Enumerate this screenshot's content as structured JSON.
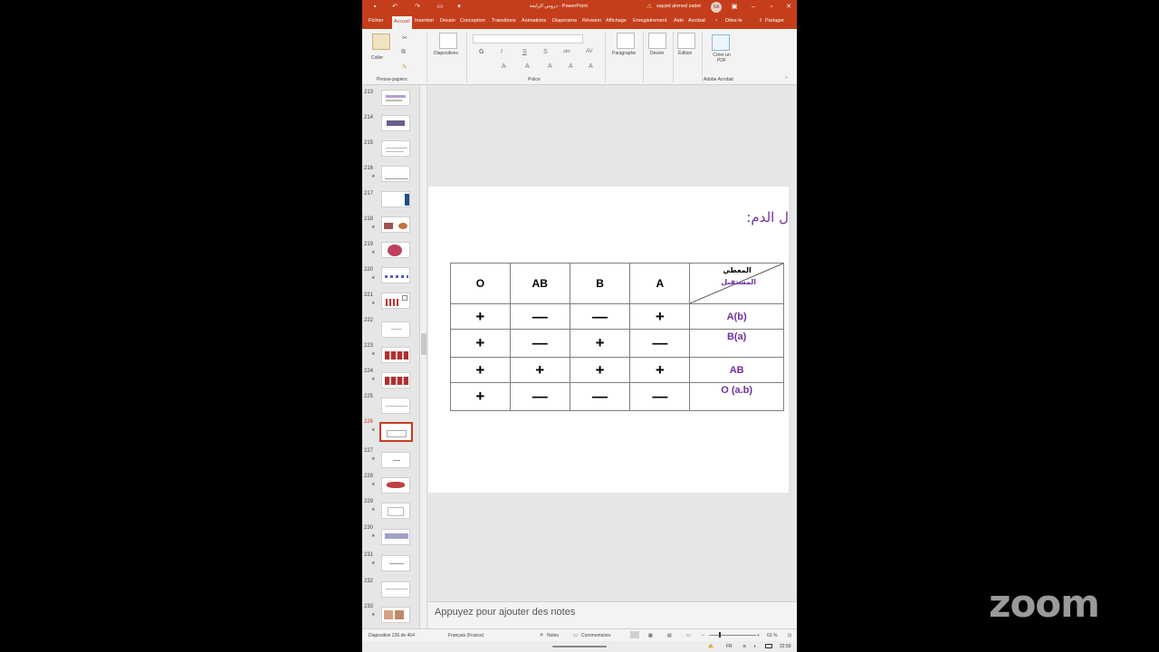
{
  "window": {
    "title": "دروس الرابعة  -  PowerPoint",
    "user": "sayyid ahmed zadet",
    "avatar_initials": "SA"
  },
  "ribbon_tabs": [
    "Fichier",
    "Accueil",
    "Insertion",
    "Dessin",
    "Conception",
    "Transitions",
    "Animations",
    "Diaporama",
    "Révision",
    "Affichage",
    "Enregistrement",
    "Aide",
    "Acrobat",
    "Dites-le",
    "Partager"
  ],
  "ribbon": {
    "paste_label": "Coller",
    "clipboard_group": "Presse-papiers",
    "slides_label": "Diapositives",
    "font_group": "Police",
    "paragraph_label": "Paragraphe",
    "drawing_label": "Dessin",
    "editing_label": "Édition",
    "create_pdf_label": "Créer un PDF",
    "acrobat_group": "Adobe Acrobat",
    "font_buttons": [
      "G",
      "I",
      "S",
      "S",
      "abc",
      "AV"
    ]
  },
  "thumbnails": [
    {
      "num": "213",
      "star": false
    },
    {
      "num": "214",
      "star": false
    },
    {
      "num": "215",
      "star": false
    },
    {
      "num": "216",
      "star": true
    },
    {
      "num": "217",
      "star": false
    },
    {
      "num": "218",
      "star": true
    },
    {
      "num": "219",
      "star": true
    },
    {
      "num": "220",
      "star": true
    },
    {
      "num": "221",
      "star": true
    },
    {
      "num": "222",
      "star": false
    },
    {
      "num": "223",
      "star": true
    },
    {
      "num": "224",
      "star": true
    },
    {
      "num": "225",
      "star": false
    },
    {
      "num": "226",
      "star": true
    },
    {
      "num": "227",
      "star": true
    },
    {
      "num": "228",
      "star": true
    },
    {
      "num": "229",
      "star": true
    },
    {
      "num": "230",
      "star": true
    },
    {
      "num": "231",
      "star": true
    },
    {
      "num": "232",
      "star": false
    },
    {
      "num": "233",
      "star": true
    }
  ],
  "current_slide": "226",
  "slide": {
    "title_fragment": "ل الدم:",
    "table": {
      "diag_top": "المعطي",
      "diag_bottom": "المستقبل",
      "columns": [
        "A",
        "B",
        "AB",
        "O"
      ],
      "rows": [
        {
          "label": "A(b)",
          "cells": [
            "+",
            "—",
            "—",
            "+"
          ]
        },
        {
          "label": "B(a)",
          "cells": [
            "—",
            "+",
            "—",
            "+"
          ]
        },
        {
          "label": "AB",
          "cells": [
            "+",
            "+",
            "+",
            "+"
          ]
        },
        {
          "label": "O (a.b)",
          "cells": [
            "—",
            "—",
            "—",
            "+"
          ]
        }
      ]
    }
  },
  "notes_placeholder": "Appuyez pour ajouter des notes",
  "status": {
    "slide_counter": "Diapositive 226 de 464",
    "language": "Français (France)",
    "notes": "Notes",
    "comments": "Commentaires",
    "zoom": "63 %"
  },
  "taskbar": {
    "lang": "FR",
    "time": "22:59"
  },
  "overlay_logo": "zoom"
}
